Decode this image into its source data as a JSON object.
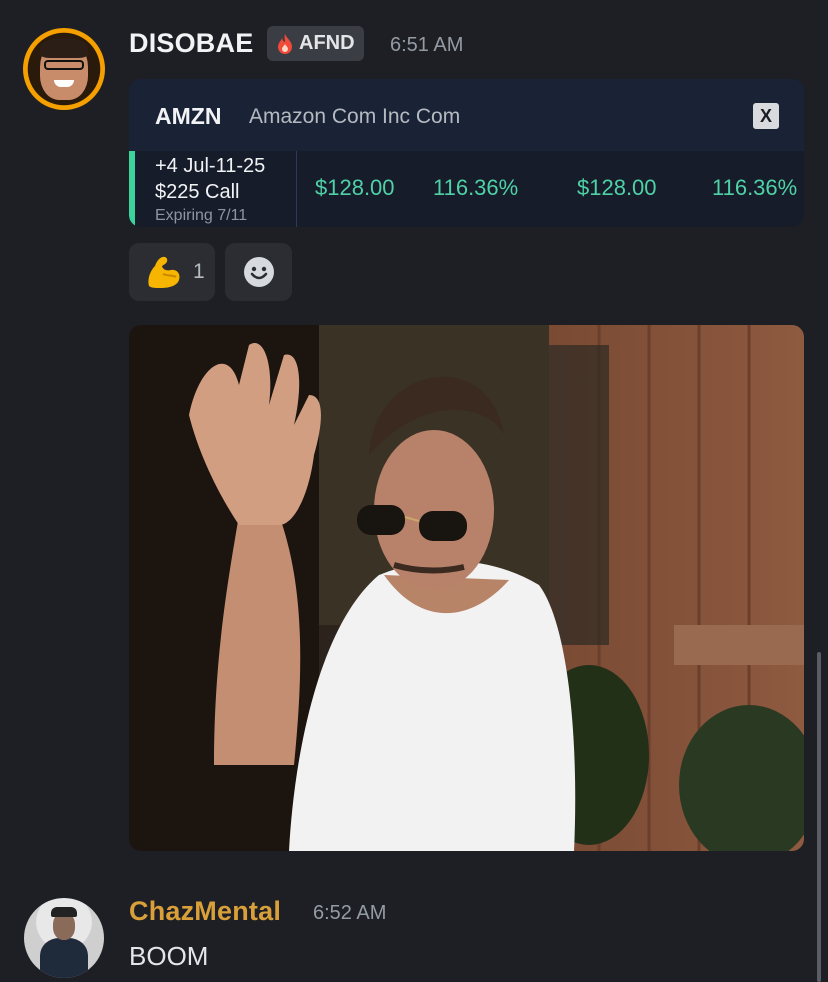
{
  "messages": [
    {
      "author": "DISOBAE",
      "tag": "AFND",
      "time": "6:51 AM",
      "embed": {
        "ticker": "AMZN",
        "company": "Amazon Com Inc Com",
        "close_label": "X",
        "contract_line1": "+4 Jul-11-25",
        "contract_line2": "$225 Call",
        "contract_line3": "Expiring 7/11",
        "values": [
          "$128.00",
          "116.36%",
          "$128.00",
          "116.36%"
        ]
      },
      "reactions": [
        {
          "emoji": "flexed-biceps",
          "count": "1"
        }
      ],
      "attachment": "gif"
    },
    {
      "author": "ChazMental",
      "time": "6:52 AM",
      "text": "BOOM"
    }
  ],
  "colors": {
    "background": "#1e1f24",
    "accent_green": "#3bd39c",
    "username_orange": "#d9a03a"
  }
}
